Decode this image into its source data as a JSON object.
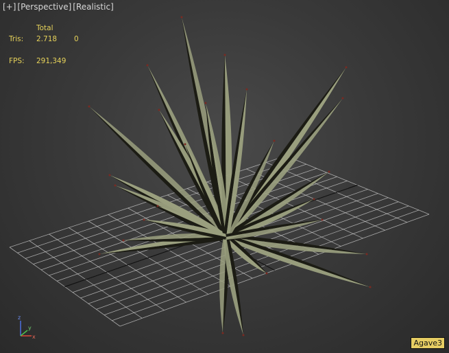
{
  "viewport": {
    "menu_plus": "[+]",
    "view_label": "[Perspective]",
    "shading_label": "[Realistic]"
  },
  "stats": {
    "total_header": "Total",
    "tris_label": "Tris:",
    "tris_total": "2.718",
    "tris_selected": "0",
    "fps_label": "FPS:",
    "fps_value": "291,349"
  },
  "object_name": "Agave3",
  "axis": {
    "z_label": "z",
    "y_label": "y",
    "x_label": "x"
  },
  "colors": {
    "stats_text": "#e6d25a",
    "grid_line": "#cfcfcf",
    "leaf_lit": "#9a9f7e",
    "leaf_shadow": "#1c1c14",
    "tag_bg": "#e6cd63"
  },
  "icons": [
    "axis-tripod-icon"
  ]
}
